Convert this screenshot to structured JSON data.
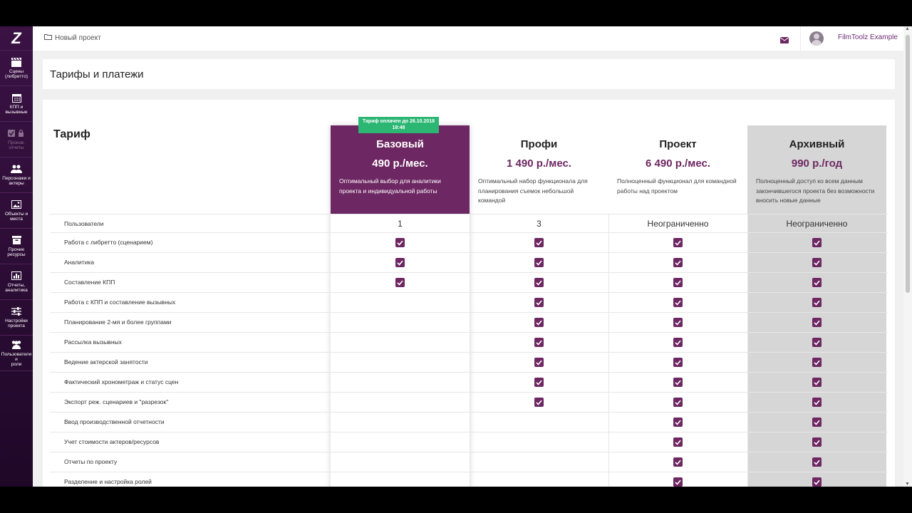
{
  "sidebar": {
    "logo": "Z",
    "items": [
      {
        "label": "Сцены\n(либретто)",
        "icon": "film-icon"
      },
      {
        "label": "КПП и\nвызывные",
        "icon": "calendar-icon"
      },
      {
        "label": "Произв.\nотчеты",
        "icon": "check-lock-icon",
        "disabled": true
      },
      {
        "label": "Персонажи и\nактеры",
        "icon": "people-icon"
      },
      {
        "label": "Объекты и\nместа",
        "icon": "image-icon"
      },
      {
        "label": "Прочие\nресурсы",
        "icon": "box-icon"
      },
      {
        "label": "Отчеты,\nаналитика",
        "icon": "chart-icon"
      },
      {
        "label": "Настройки\nпроекта",
        "icon": "sliders-icon"
      },
      {
        "label": "Пользователи и\nроли",
        "icon": "users-icon"
      }
    ]
  },
  "header": {
    "breadcrumb": "Новый проект",
    "user_name": "FilmToolz Example"
  },
  "page": {
    "title": "Тарифы и платежи",
    "tariff_label": "Тариф"
  },
  "plans": [
    {
      "name": "Базовый",
      "price": "490 р./мес.",
      "description": "Оптимальный выбор для аналитики проекта и индивидуальной работы",
      "users": "1",
      "badge": "Тариф оплачен до 26.10.2018 18:48"
    },
    {
      "name": "Профи",
      "price": "1 490 р./мес.",
      "description": "Оптимальный набор функционала для планирования съемок небольшой командой",
      "users": "3"
    },
    {
      "name": "Проект",
      "price": "6 490 р./мес.",
      "description": "Полноценный функционал для командной работы над проектом",
      "users": "Неограниченно"
    },
    {
      "name": "Архивный",
      "price": "990 р./год",
      "description": "Полноценный доступ ко всем данным закончившегося проекта без возможности вносить новые данные",
      "users": "Неограниченно"
    }
  ],
  "users_row_label": "Пользователи",
  "features": [
    {
      "label": "Работа с либретто (сценарием)",
      "plans": [
        true,
        true,
        true,
        true
      ]
    },
    {
      "label": "Аналитика",
      "plans": [
        true,
        true,
        true,
        true
      ]
    },
    {
      "label": "Составление КПП",
      "plans": [
        true,
        true,
        true,
        true
      ]
    },
    {
      "label": "Работа с КПП и составление вызывных",
      "plans": [
        false,
        true,
        true,
        true
      ]
    },
    {
      "label": "Планирование 2-мя и более группами",
      "plans": [
        false,
        true,
        true,
        true
      ]
    },
    {
      "label": "Рассылка вызывных",
      "plans": [
        false,
        true,
        true,
        true
      ]
    },
    {
      "label": "Ведение актерской занятости",
      "plans": [
        false,
        true,
        true,
        true
      ]
    },
    {
      "label": "Фактический хронометраж и статус сцен",
      "plans": [
        false,
        true,
        true,
        true
      ]
    },
    {
      "label": "Экспорт реж. сценариев и \"разрезок\"",
      "plans": [
        false,
        true,
        true,
        true
      ]
    },
    {
      "label": "Ввод производственной отчетности",
      "plans": [
        false,
        false,
        true,
        true
      ]
    },
    {
      "label": "Учет стоимости актеров/ресурсов",
      "plans": [
        false,
        false,
        true,
        true
      ]
    },
    {
      "label": "Отчеты по проекту",
      "plans": [
        false,
        false,
        true,
        true
      ]
    },
    {
      "label": "Разделение и настройка ролей",
      "plans": [
        false,
        false,
        true,
        true
      ]
    }
  ],
  "colors": {
    "accent": "#6d2762",
    "badge": "#2bb673",
    "archive_bg": "#d6d6d6"
  }
}
